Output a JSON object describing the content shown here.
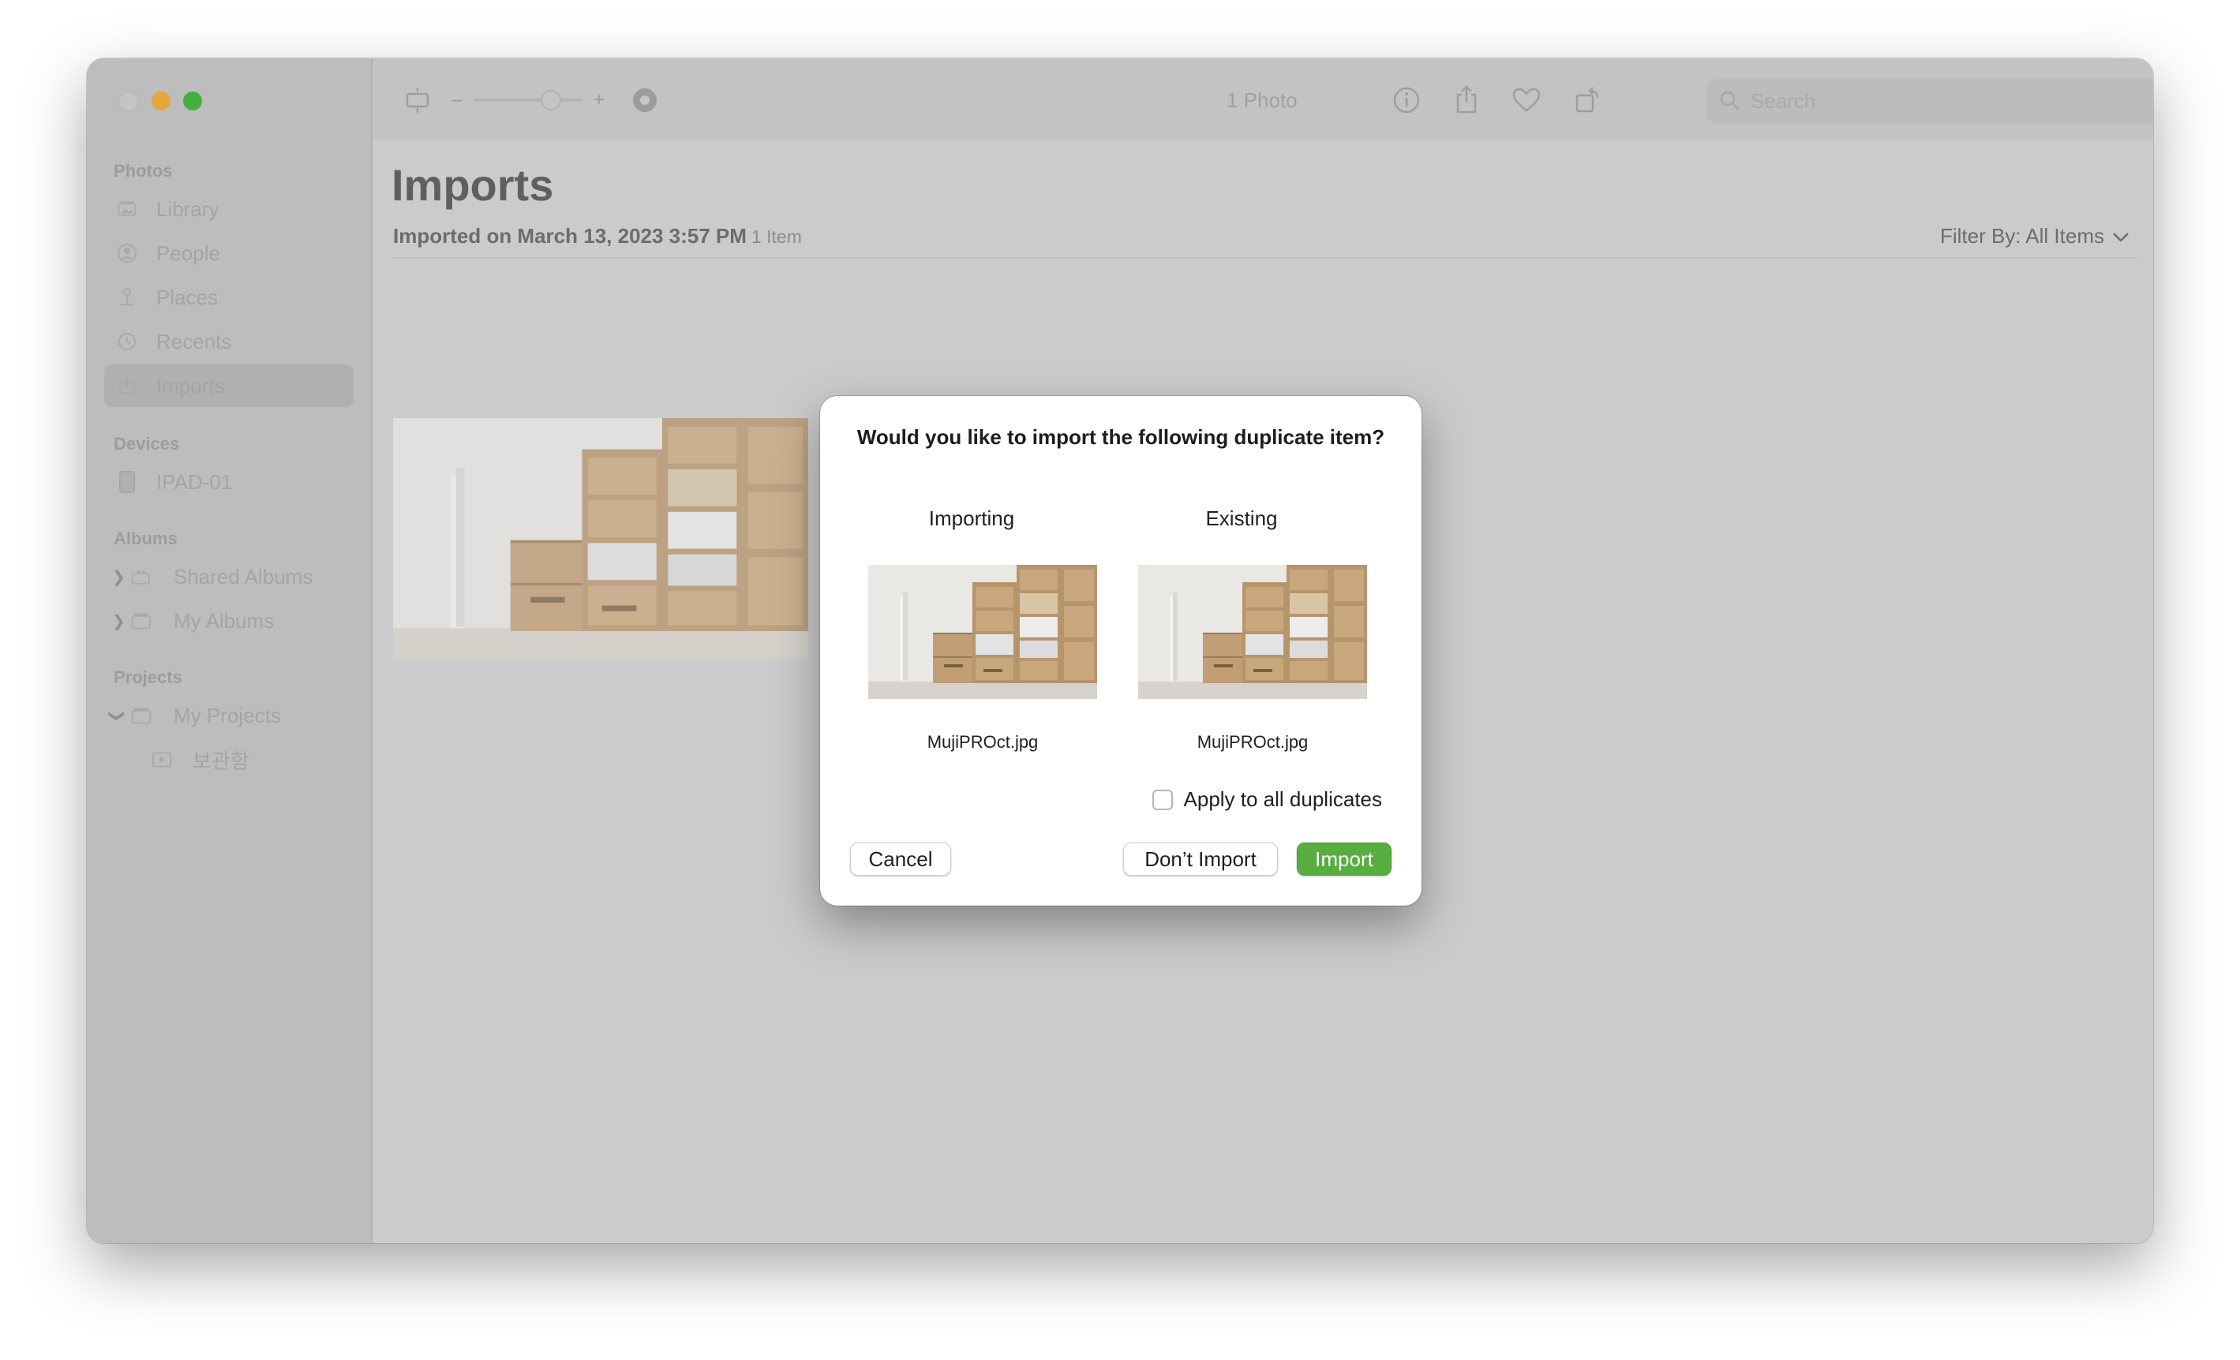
{
  "window": {
    "photo_count": "1 Photo",
    "search_placeholder": "Search"
  },
  "sidebar": {
    "sections": {
      "photos": "Photos",
      "devices": "Devices",
      "albums": "Albums",
      "projects": "Projects"
    },
    "photos_items": [
      {
        "label": "Library",
        "icon": "library-icon"
      },
      {
        "label": "People",
        "icon": "person-icon"
      },
      {
        "label": "Places",
        "icon": "pin-icon"
      },
      {
        "label": "Recents",
        "icon": "clock-icon"
      },
      {
        "label": "Imports",
        "icon": "import-icon",
        "selected": true
      }
    ],
    "devices_items": [
      {
        "label": "IPAD-01",
        "icon": "ipad-icon"
      }
    ],
    "albums_items": [
      {
        "label": "Shared Albums",
        "icon": "folder-icon"
      },
      {
        "label": "My Albums",
        "icon": "folder-icon"
      }
    ],
    "projects_items": [
      {
        "label": "My Projects",
        "icon": "folder-icon"
      },
      {
        "label": "보관함",
        "icon": "slideshow-icon"
      }
    ]
  },
  "main": {
    "title": "Imports",
    "import_label": "Imported on March 13, 2023 3:57 PM",
    "item_count": "1 Item",
    "filter_label": "Filter By: All Items"
  },
  "dialog": {
    "title": "Would you like to import the following duplicate item?",
    "importing_label": "Importing",
    "existing_label": "Existing",
    "importing_file": "MujiPROct.jpg",
    "existing_file": "MujiPROct.jpg",
    "apply_all_label": "Apply to all duplicates",
    "apply_all_checked": false,
    "cancel_label": "Cancel",
    "dont_import_label": "Don’t Import",
    "import_label": "Import",
    "accent_color": "#57ae3e"
  }
}
